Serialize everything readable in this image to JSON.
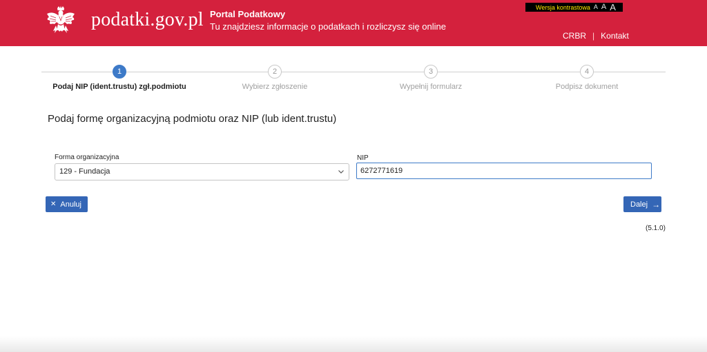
{
  "header": {
    "site_name": "podatki.gov.pl",
    "portal_title": "Portal Podatkowy",
    "portal_subtitle": "Tu znajdziesz informacje o podatkach i rozliczysz się online",
    "contrast_label": "Wersja kontrastowa",
    "font_sizes": [
      "A",
      "A",
      "A"
    ],
    "links": [
      "CRBR",
      "Kontakt"
    ],
    "separator": "|",
    "brand_color": "#d4213d"
  },
  "stepper": {
    "steps": [
      {
        "number": "1",
        "label": "Podaj NIP (ident.trustu) zgł.podmiotu",
        "active": true
      },
      {
        "number": "2",
        "label": "Wybierz zgłoszenie",
        "active": false
      },
      {
        "number": "3",
        "label": "Wypełnij formularz",
        "active": false
      },
      {
        "number": "4",
        "label": "Podpisz dokument",
        "active": false
      }
    ],
    "active_color": "#3d7ac8"
  },
  "main": {
    "title": "Podaj formę organizacyjną podmiotu oraz NIP (lub ident.trustu)",
    "org_form": {
      "label": "Forma organizacyjna",
      "value": "129 - Fundacja"
    },
    "nip": {
      "label": "NIP",
      "value": "6272771619"
    },
    "cancel_label": "Anuluj",
    "next_label": "Dalej",
    "version": "(5.1.0)",
    "button_color": "#3466b6"
  }
}
